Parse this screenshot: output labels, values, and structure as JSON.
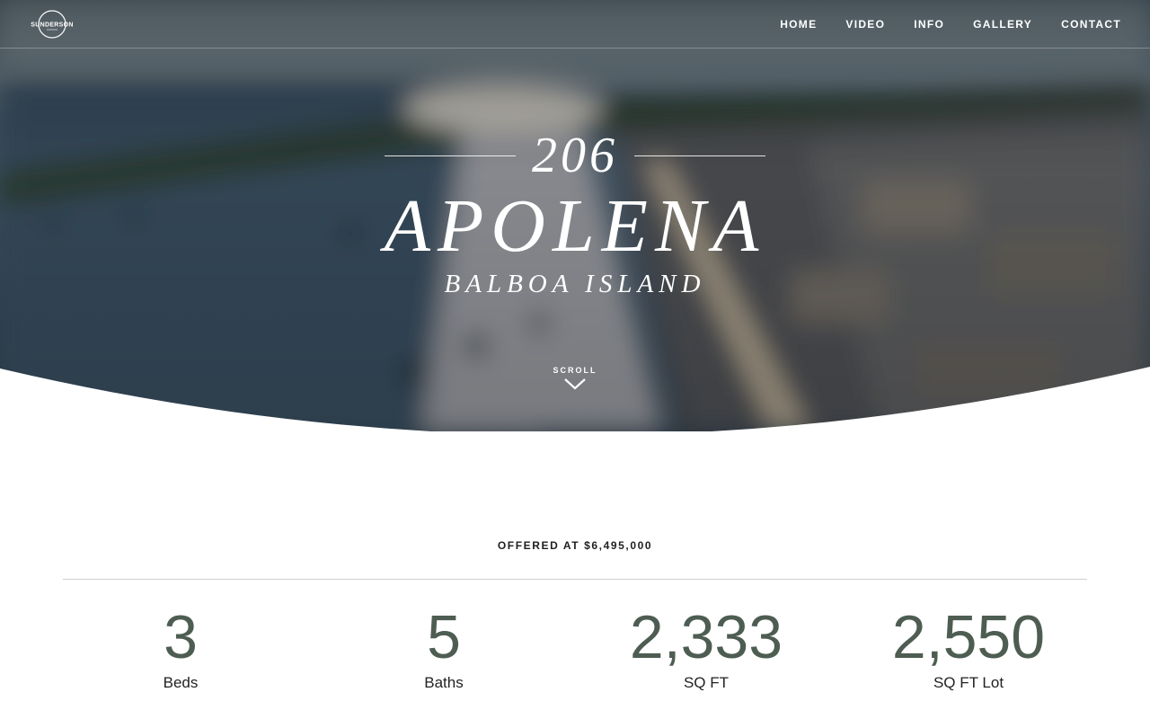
{
  "header": {
    "logo_text": "SUNDERSON",
    "nav": [
      "HOME",
      "VIDEO",
      "INFO",
      "GALLERY",
      "CONTACT"
    ]
  },
  "hero": {
    "number": "206",
    "street": "APOLENA",
    "area": "BALBOA ISLAND",
    "scroll_label": "SCROLL"
  },
  "listing": {
    "offered": "OFFERED AT $6,495,000",
    "stats": [
      {
        "value": "3",
        "label": "Beds"
      },
      {
        "value": "5",
        "label": "Baths"
      },
      {
        "value": "2,333",
        "label": "SQ FT"
      },
      {
        "value": "2,550",
        "label": "SQ FT Lot"
      }
    ]
  },
  "colors": {
    "stat_value": "#4e5d52",
    "hero_overlay": "#3b4a55"
  }
}
